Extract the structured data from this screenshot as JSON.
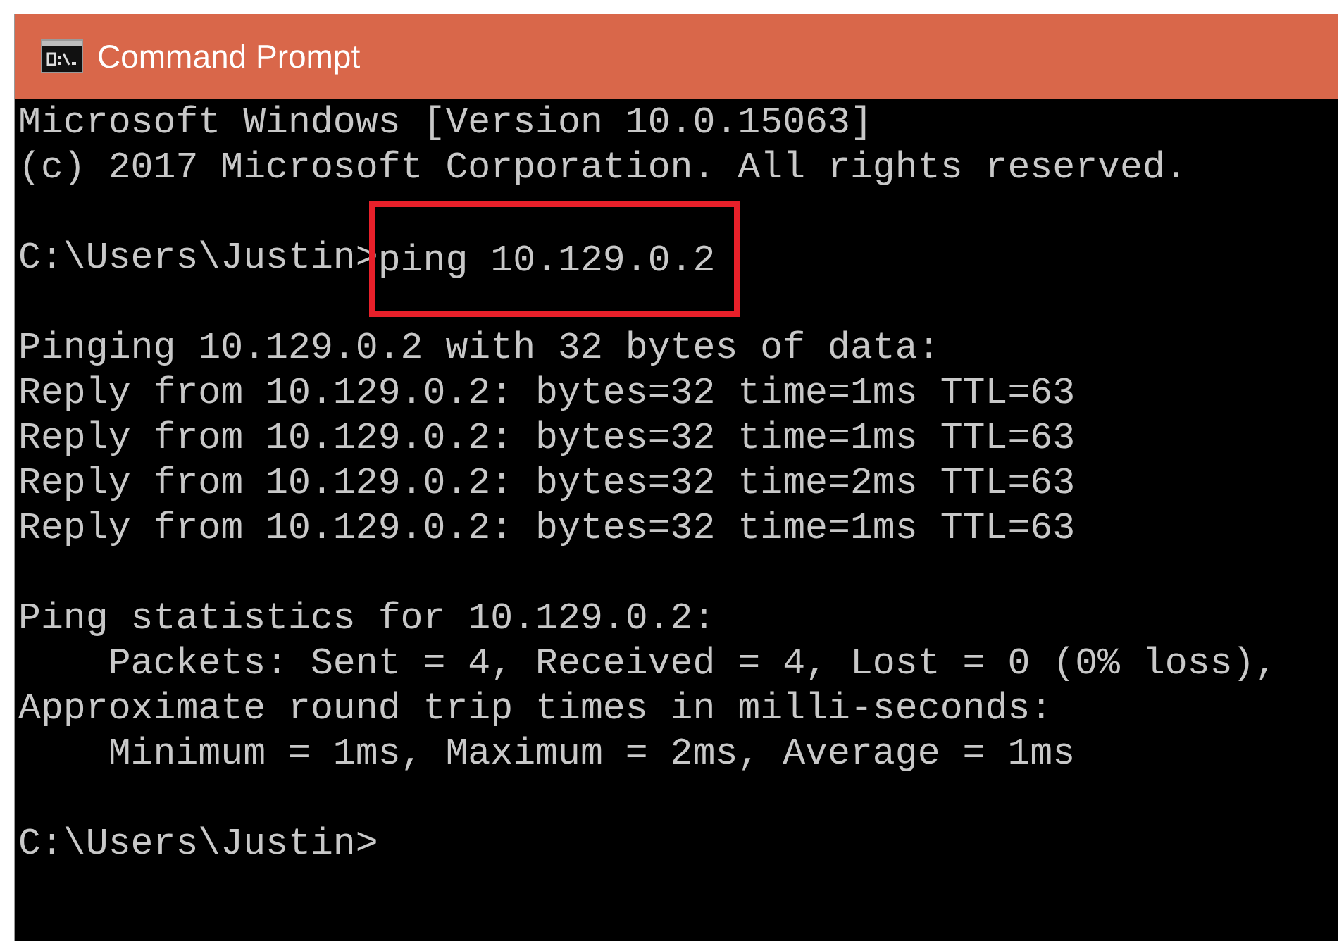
{
  "window": {
    "title": "Command Prompt"
  },
  "console": {
    "lines": [
      {
        "kind": "text",
        "text": "Microsoft Windows [Version 10.0.15063]"
      },
      {
        "kind": "text",
        "text": "(c) 2017 Microsoft Corporation. All rights reserved."
      },
      {
        "kind": "blank"
      },
      {
        "kind": "prompt",
        "prompt": "C:\\Users\\Justin>",
        "command": "ping 10.129.0.2",
        "highlighted": true
      },
      {
        "kind": "blank"
      },
      {
        "kind": "text",
        "text": "Pinging 10.129.0.2 with 32 bytes of data:"
      },
      {
        "kind": "text",
        "text": "Reply from 10.129.0.2: bytes=32 time=1ms TTL=63"
      },
      {
        "kind": "text",
        "text": "Reply from 10.129.0.2: bytes=32 time=1ms TTL=63"
      },
      {
        "kind": "text",
        "text": "Reply from 10.129.0.2: bytes=32 time=2ms TTL=63"
      },
      {
        "kind": "text",
        "text": "Reply from 10.129.0.2: bytes=32 time=1ms TTL=63"
      },
      {
        "kind": "blank"
      },
      {
        "kind": "text",
        "text": "Ping statistics for 10.129.0.2:"
      },
      {
        "kind": "text",
        "text": "    Packets: Sent = 4, Received = 4, Lost = 0 (0% loss),"
      },
      {
        "kind": "text",
        "text": "Approximate round trip times in milli-seconds:"
      },
      {
        "kind": "text",
        "text": "    Minimum = 1ms, Maximum = 2ms, Average = 1ms"
      },
      {
        "kind": "blank"
      },
      {
        "kind": "prompt",
        "prompt": "C:\\Users\\Justin>"
      }
    ]
  }
}
